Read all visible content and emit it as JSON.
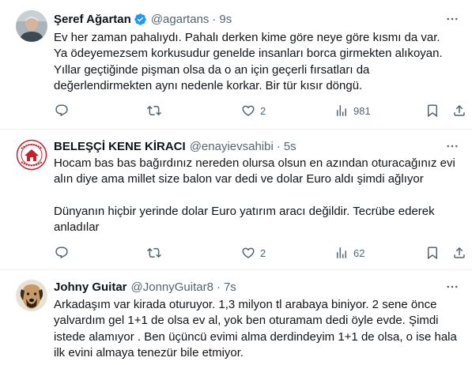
{
  "tweets": [
    {
      "name": "Şeref Ağartan",
      "handle": "@agartans",
      "separator": "·",
      "time": "9s",
      "verified": true,
      "lines": [
        "Ev her zaman pahalıydı. Pahalı derken kime göre neye göre kısmı da var.",
        "Ya ödeyemezsem korkusudur genelde insanları borca girmekten alıkoyan.",
        "Yıllar geçtiğinde pişman olsa da o an için geçerli fırsatları da",
        "değerlendirmekten aynı nedenle korkar. Bir tür kısır döngü."
      ],
      "likes": "2",
      "views": "981"
    },
    {
      "name": "BELEŞÇİ KENE KİRACI",
      "handle": "@enayievsahibi",
      "separator": "·",
      "time": "5s",
      "verified": false,
      "lines": [
        "Hocam bas bas bağırdınız nereden olursa olsun en azından oturacağınız evi",
        "alın diye ama millet size balon var dedi ve dolar Euro aldı şimdi ağlıyor",
        "",
        "Dünyanın hiçbir yerinde dolar Euro yatırım aracı değildir. Tecrübe ederek",
        "anladılar"
      ],
      "likes": "2",
      "views": "62"
    },
    {
      "name": "Johny Guitar",
      "handle": "@JonnyGuitar8",
      "separator": "·",
      "time": "7s",
      "verified": false,
      "lines": [
        "Arkadaşım  var kirada oturuyor. 1,3 milyon tl arabaya biniyor. 2 sene önce",
        "yalvardım gel 1+1 de olsa ev al, yok ben oturamam dedi öyle evde. Şimdi",
        "istede alamıyor . Ben üçüncü evimi alma derdindeyim 1+1 de olsa, o ise hala",
        "ilk evini almaya tenezür bile etmiyor."
      ]
    }
  ],
  "colors": {
    "text": "#0f1419",
    "secondary": "#536471",
    "verified_blue": "#1d9bf0",
    "divider": "#eff3f4"
  },
  "icons": [
    "more-icon",
    "reply-icon",
    "retweet-icon",
    "like-icon",
    "views-icon",
    "bookmark-icon",
    "share-icon",
    "verified-badge-icon"
  ]
}
